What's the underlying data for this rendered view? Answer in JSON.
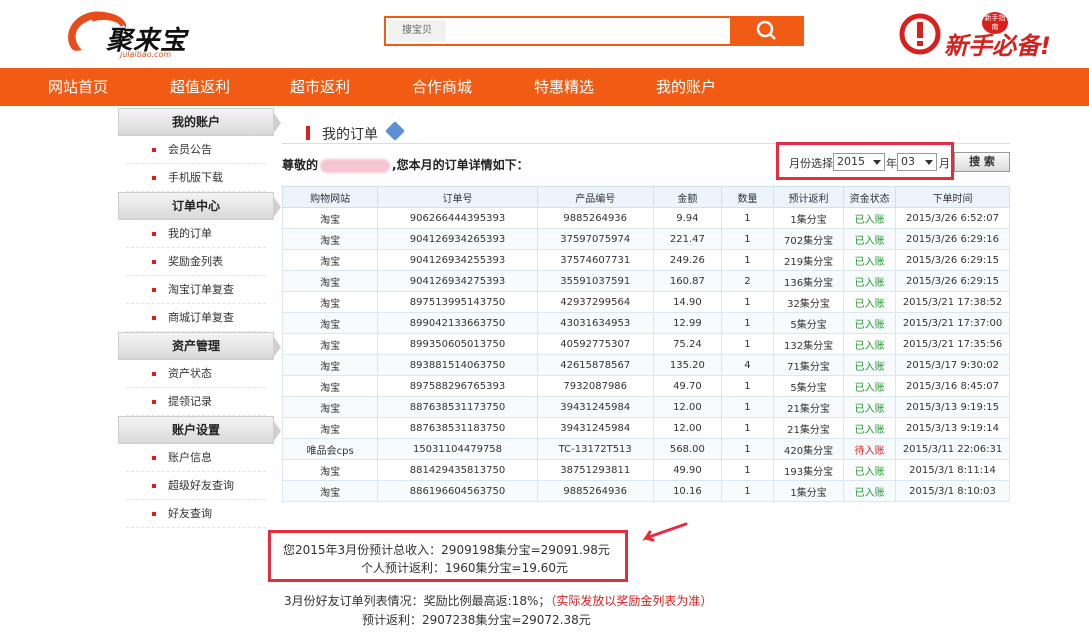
{
  "header": {
    "logo_text": "聚来宝",
    "logo_sub": "julaibao.com",
    "search_label": "搜宝贝",
    "search_placeholder": "",
    "newbie_text": "新手必备!",
    "newbie_badge": "新手指南"
  },
  "nav": {
    "items": [
      "网站首页",
      "超值返利",
      "超市返利",
      "合作商城",
      "特惠精选",
      "我的账户"
    ]
  },
  "sidebar": {
    "sections": [
      {
        "title": "我的账户",
        "items": [
          "会员公告",
          "手机版下载"
        ]
      },
      {
        "title": "订单中心",
        "items": [
          "我的订单",
          "奖励金列表",
          "淘宝订单复查",
          "商城订单复查"
        ]
      },
      {
        "title": "资产管理",
        "items": [
          "资产状态",
          "提领记录"
        ]
      },
      {
        "title": "账户设置",
        "items": [
          "账户信息",
          "超级好友查询",
          "好友查询"
        ]
      }
    ]
  },
  "main": {
    "title": "我的订单",
    "greeting_prefix": "尊敬的",
    "greeting_suffix": ",您本月的订单详情如下：",
    "month_label": "月份选择",
    "year_value": "2015",
    "year_suffix": "年",
    "month_value": "03",
    "month_suffix": "月",
    "search_button": "搜 索"
  },
  "table": {
    "columns": [
      "购物网站",
      "订单号",
      "产品编号",
      "金额",
      "数量",
      "预计返利",
      "资金状态",
      "下单时间"
    ],
    "rows": [
      [
        "淘宝",
        "906266444395393",
        "9885264936",
        "9.94",
        "1",
        "1集分宝",
        "已入账",
        "2015/3/26 6:52:07"
      ],
      [
        "淘宝",
        "904126934265393",
        "37597075974",
        "221.47",
        "1",
        "702集分宝",
        "已入账",
        "2015/3/26 6:29:16"
      ],
      [
        "淘宝",
        "904126934255393",
        "37574607731",
        "249.26",
        "1",
        "219集分宝",
        "已入账",
        "2015/3/26 6:29:15"
      ],
      [
        "淘宝",
        "904126934275393",
        "35591037591",
        "160.87",
        "2",
        "136集分宝",
        "已入账",
        "2015/3/26 6:29:15"
      ],
      [
        "淘宝",
        "897513995143750",
        "42937299564",
        "14.90",
        "1",
        "32集分宝",
        "已入账",
        "2015/3/21 17:38:52"
      ],
      [
        "淘宝",
        "899042133663750",
        "43031634953",
        "12.99",
        "1",
        "5集分宝",
        "已入账",
        "2015/3/21 17:37:00"
      ],
      [
        "淘宝",
        "899350605013750",
        "40592775307",
        "75.24",
        "1",
        "132集分宝",
        "已入账",
        "2015/3/21 17:35:56"
      ],
      [
        "淘宝",
        "893881514063750",
        "42615878567",
        "135.20",
        "4",
        "71集分宝",
        "已入账",
        "2015/3/17 9:30:02"
      ],
      [
        "淘宝",
        "897588296765393",
        "7932087986",
        "49.70",
        "1",
        "5集分宝",
        "已入账",
        "2015/3/16 8:45:07"
      ],
      [
        "淘宝",
        "887638531173750",
        "39431245984",
        "12.00",
        "1",
        "21集分宝",
        "已入账",
        "2015/3/13 9:19:15"
      ],
      [
        "淘宝",
        "887638531183750",
        "39431245984",
        "12.00",
        "1",
        "21集分宝",
        "已入账",
        "2015/3/13 9:19:14"
      ],
      [
        "唯品会cps",
        "15031104479758",
        "TC-13172T513",
        "568.00",
        "1",
        "420集分宝",
        "待入账",
        "2015/3/11 22:06:31"
      ],
      [
        "淘宝",
        "881429435813750",
        "38751293811",
        "49.90",
        "1",
        "193集分宝",
        "已入账",
        "2015/3/1 8:11:14"
      ],
      [
        "淘宝",
        "886196604563750",
        "9885264936",
        "10.16",
        "1",
        "1集分宝",
        "已入账",
        "2015/3/1 8:10:03"
      ]
    ],
    "status_in": "已入账",
    "status_pending": "待入账",
    "status_in_color": "#1f9a2a",
    "status_pending_color": "#d8201c"
  },
  "summary": {
    "line1": "您2015年3月份预计总收入：2909198集分宝=29091.98元",
    "line2": "个人预计返利：1960集分宝=19.60元",
    "friend_line1": "3月份好友订单列表情况：奖励比例最高返:18%；",
    "friend_note": "（实际发放以奖励金列表为准）",
    "friend_line2": "预计返利：2907238集分宝=29072.38元"
  },
  "colors": {
    "brand_orange": "#f25b13",
    "highlight_red": "#e62d40"
  }
}
